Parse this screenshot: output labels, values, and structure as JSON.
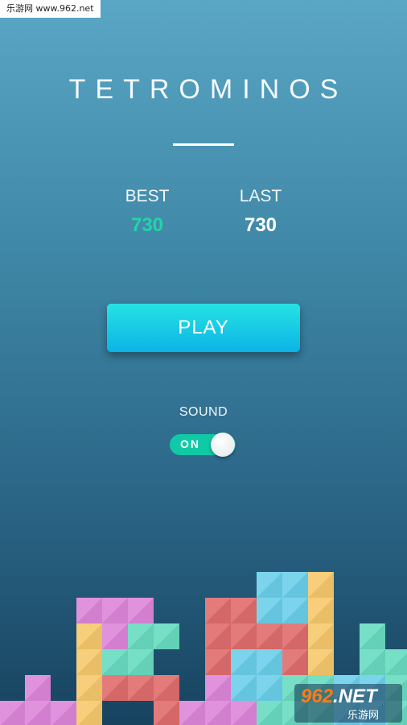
{
  "watermark_top": "乐游网 www.962.net",
  "title": "TETROMINOS",
  "scores": {
    "best_label": "BEST",
    "best_value": "730",
    "last_label": "LAST",
    "last_value": "730"
  },
  "play_label": "PLAY",
  "sound": {
    "label": "SOUND",
    "toggle_text": "ON",
    "enabled": true
  },
  "watermark_logo": {
    "num": "962",
    "suffix": ".NET",
    "site": "乐游网"
  },
  "colors": {
    "accent_teal": "#10c9a6",
    "best_value": "#1fd6a5",
    "play_button_top": "#26e3e3",
    "play_button_bottom": "#0cb3e6",
    "block_pink": "#dd86da",
    "block_yellow": "#f7c96c",
    "block_red": "#e06d6d",
    "block_cyan": "#6cd0ea",
    "block_mint": "#69dcc1"
  }
}
